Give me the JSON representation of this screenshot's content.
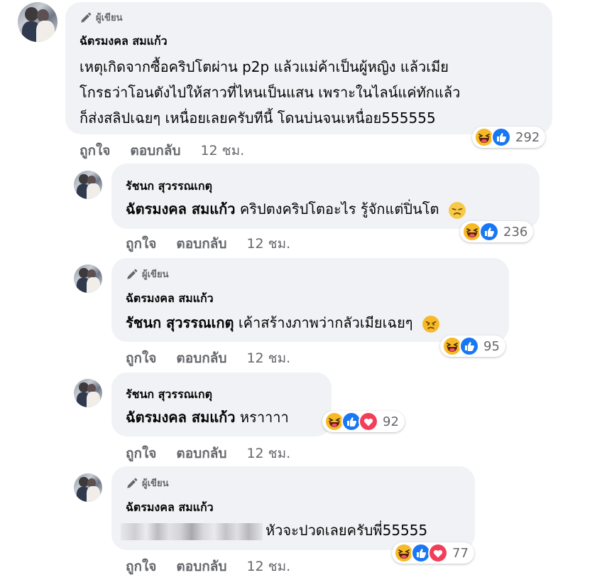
{
  "author_badge": "ผู้เขียน",
  "comments": [
    {
      "name": "ฉัตรมงคล สมแก้ว",
      "lines": [
        "เหตุเกิดจากซื้อคริปโตผ่าน p2p แล้วแม่ค้าเป็นผู้หญิง แล้วเมีย",
        "โกรธว่าโอนตังไปให้สาวที่ไหนเป็นแสน เพราะในไลน์แค่ทักแล้ว",
        "ก็ส่งสลิปเฉยๆ เหนื่อยเลยครับทีนี้ โดนบ่นจนเหนื่อย555555"
      ],
      "reaction_count": "292",
      "like": "ถูกใจ",
      "reply": "ตอบกลับ",
      "time": "12 ชม."
    },
    {
      "name": "รัชนก สุวรรณเกตุ",
      "mention": "ฉัตรมงคล สมแก้ว",
      "text": " คริปตงคริปโตอะไร รู้จักแต่ปิ่นโต",
      "reaction_count": "236",
      "like": "ถูกใจ",
      "reply": "ตอบกลับ",
      "time": "12 ชม."
    },
    {
      "name": "ฉัตรมงคล สมแก้ว",
      "mention": "รัชนก สุวรรณเกตุ",
      "text": " เค้าสร้างภาพว่ากลัวเมียเฉยๆ",
      "reaction_count": "95",
      "like": "ถูกใจ",
      "reply": "ตอบกลับ",
      "time": "12 ชม."
    },
    {
      "name": "รัชนก สุวรรณเกตุ",
      "mention": "ฉัตรมงคล สมแก้ว",
      "text": " หราาาา",
      "reaction_count": "92",
      "like": "ถูกใจ",
      "reply": "ตอบกลับ",
      "time": "12 ชม."
    },
    {
      "name": "ฉัตรมงคล สมแก้ว",
      "text": "หัวจะปวดเลยครับพี่55555",
      "reaction_count": "77",
      "like": "ถูกใจ",
      "reply": "ตอบกลับ",
      "time": "12 ชม."
    }
  ],
  "colors": {
    "bubble": "#f0f2f5",
    "like_blue": "#1877f2",
    "haha_yellow": "#f7b928",
    "love_red": "#f33e58",
    "meta_text": "#65676b"
  },
  "icons": [
    "pencil-icon",
    "haha-icon",
    "like-icon",
    "love-icon",
    "sad-face-emoji",
    "angry-face-emoji"
  ]
}
